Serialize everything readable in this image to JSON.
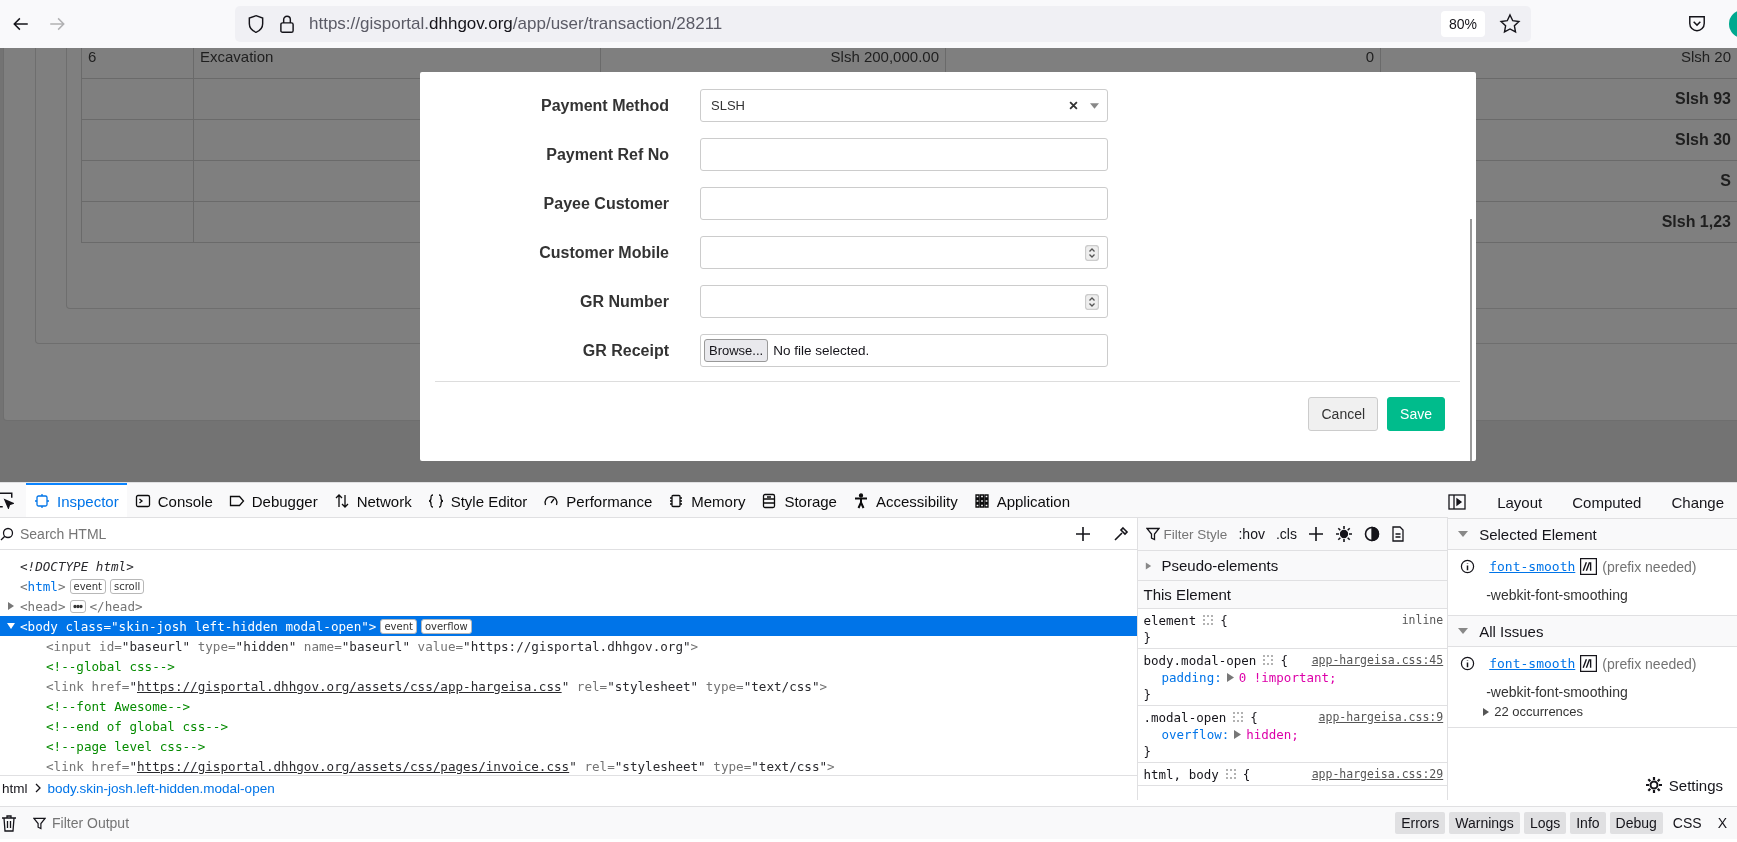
{
  "browser": {
    "back_button": {
      "disabled": false
    },
    "forward_button": {
      "disabled": true
    },
    "url": [
      {
        "text": "https://gisportal.",
        "emphasis": false
      },
      {
        "text": "dhhgov.org",
        "emphasis": true
      },
      {
        "text": "/app/user/transaction/28211",
        "emphasis": false
      }
    ],
    "zoom": "80%"
  },
  "page": {
    "table": {
      "rows": [
        {
          "bold": false,
          "column_1": "6",
          "column_2": "Excavation",
          "column_3": "Slsh 200,000.00",
          "column_4": "0",
          "column_5": "Slsh 20"
        },
        {
          "bold": true,
          "column_5": "Slsh 93"
        },
        {
          "bold": true,
          "column_5": "Slsh 30"
        },
        {
          "bold": true,
          "column_5": "S"
        },
        {
          "bold": true,
          "column_5": "Slsh 1,23"
        }
      ]
    }
  },
  "modal": {
    "fields": [
      {
        "label": "Payment Method",
        "kind": "select",
        "value": "SLSH"
      },
      {
        "label": "Payment Ref No",
        "kind": "text"
      },
      {
        "label": "Payee Customer",
        "kind": "text"
      },
      {
        "label": "Customer Mobile",
        "kind": "number"
      },
      {
        "label": "GR Number",
        "kind": "number"
      },
      {
        "label": "GR Receipt",
        "kind": "file",
        "button": "Browse...",
        "status": "No file selected."
      }
    ],
    "buttons": [
      {
        "label": "Cancel",
        "kind": "secondary"
      },
      {
        "label": "Save",
        "kind": "primary"
      }
    ]
  },
  "devtools": {
    "tabs": [
      {
        "label": "Inspector",
        "selected": true
      },
      {
        "label": "Console",
        "selected": false
      },
      {
        "label": "Debugger",
        "selected": false
      },
      {
        "label": "Network",
        "selected": false
      },
      {
        "label": "Style Editor",
        "selected": false
      },
      {
        "label": "Performance",
        "selected": false
      },
      {
        "label": "Memory",
        "selected": false
      },
      {
        "label": "Storage",
        "selected": false
      },
      {
        "label": "Accessibility",
        "selected": false
      },
      {
        "label": "Application",
        "selected": false
      }
    ],
    "search": {
      "placeholder": "Search HTML"
    },
    "markup": [
      {
        "selected": false,
        "parts": [
          {
            "kind": "doctype",
            "text": "<!DOCTYPE html>"
          }
        ]
      },
      {
        "selected": false,
        "parts": [
          {
            "kind": "punct",
            "text": "<"
          },
          {
            "kind": "tag",
            "text": "html"
          },
          {
            "kind": "punct",
            "text": ">"
          },
          {
            "kind": "badge",
            "text": "event"
          },
          {
            "kind": "badge",
            "text": "scroll"
          }
        ]
      },
      {
        "selected": false,
        "expanded": false,
        "parts": [
          {
            "kind": "punct",
            "text": "<head>"
          },
          {
            "kind": "ellipsis"
          },
          {
            "kind": "punct",
            "text": "</head>"
          }
        ]
      },
      {
        "selected": true,
        "expanded": true,
        "parts": [
          {
            "kind": "punct",
            "text": "<"
          },
          {
            "kind": "tag",
            "text": "body"
          },
          {
            "kind": "attr",
            "text": " class="
          },
          {
            "kind": "value",
            "text": "\"skin-josh left-hidden modal-open\""
          },
          {
            "kind": "punct",
            "text": ">"
          },
          {
            "kind": "badge",
            "text": "event"
          },
          {
            "kind": "badge",
            "text": "overflow"
          }
        ],
        "children": [
          {
            "selected": false,
            "parts": [
              {
                "kind": "punct",
                "text": "<input"
              },
              {
                "kind": "attr",
                "text": " id="
              },
              {
                "kind": "value",
                "text": "\"baseurl\""
              },
              {
                "kind": "attr",
                "text": " type="
              },
              {
                "kind": "value",
                "text": "\"hidden\""
              },
              {
                "kind": "attr",
                "text": " name="
              },
              {
                "kind": "value",
                "text": "\"baseurl\""
              },
              {
                "kind": "attr",
                "text": " value="
              },
              {
                "kind": "value",
                "text": "\"https://gisportal.dhhgov.org\""
              },
              {
                "kind": "punct",
                "text": ">"
              }
            ]
          },
          {
            "selected": false,
            "parts": [
              {
                "kind": "comment",
                "text": "<!--global css-->"
              }
            ]
          },
          {
            "selected": false,
            "parts": [
              {
                "kind": "punct",
                "text": "<link"
              },
              {
                "kind": "attr",
                "text": " href="
              },
              {
                "kind": "value",
                "text": "\""
              },
              {
                "kind": "link",
                "text": "https://gisportal.dhhgov.org/assets/css/app-hargeisa.css"
              },
              {
                "kind": "value",
                "text": "\""
              },
              {
                "kind": "attr",
                "text": " rel="
              },
              {
                "kind": "value",
                "text": "\"stylesheet\""
              },
              {
                "kind": "attr",
                "text": " type="
              },
              {
                "kind": "value",
                "text": "\"text/css\""
              },
              {
                "kind": "punct",
                "text": ">"
              }
            ]
          },
          {
            "selected": false,
            "parts": [
              {
                "kind": "comment",
                "text": "<!--font Awesome-->"
              }
            ]
          },
          {
            "selected": false,
            "parts": [
              {
                "kind": "comment",
                "text": "<!--end of global css-->"
              }
            ]
          },
          {
            "selected": false,
            "parts": [
              {
                "kind": "comment",
                "text": "<!--page level css-->"
              }
            ]
          },
          {
            "selected": false,
            "parts": [
              {
                "kind": "punct",
                "text": "<link"
              },
              {
                "kind": "attr",
                "text": " href="
              },
              {
                "kind": "value",
                "text": "\""
              },
              {
                "kind": "link",
                "text": "https://gisportal.dhhgov.org/assets/css/pages/invoice.css"
              },
              {
                "kind": "value",
                "text": "\""
              },
              {
                "kind": "attr",
                "text": " rel="
              },
              {
                "kind": "value",
                "text": "\"stylesheet\""
              },
              {
                "kind": "attr",
                "text": " type="
              },
              {
                "kind": "value",
                "text": "\"text/css\""
              },
              {
                "kind": "punct",
                "text": ">"
              }
            ]
          }
        ]
      }
    ],
    "breadcrumb": [
      {
        "label": "html",
        "selected": false
      },
      {
        "label": "body.skin-josh.left-hidden.modal-open",
        "selected": true
      }
    ],
    "rules": {
      "filter": {
        "placeholder": "Filter Style"
      },
      "toggles": [
        ":hov",
        ".cls"
      ],
      "pseudo_elements": {
        "label": "Pseudo-elements",
        "expanded": false
      },
      "header": "This Element",
      "list": [
        {
          "selector": "element",
          "open": "{",
          "source": "inline",
          "source_link": false,
          "close": "}"
        },
        {
          "selector": "body.modal-open",
          "open": "{",
          "source": "app-hargeisa.css:45",
          "source_link": true,
          "declarations": [
            {
              "property": "padding:",
              "value": "0 !important;"
            }
          ],
          "close": "}"
        },
        {
          "selector": ".modal-open",
          "open": "{",
          "source": "app-hargeisa.css:9",
          "source_link": true,
          "declarations": [
            {
              "property": "overflow:",
              "value": "hidden;"
            }
          ],
          "close": "}"
        },
        {
          "selector": "html, body",
          "open": "{",
          "source": "app-hargeisa.css:29",
          "source_link": true
        }
      ]
    },
    "sidebar": {
      "tabs": [
        {
          "label": "Layout",
          "selected": false
        },
        {
          "label": "Computed",
          "selected": false
        },
        {
          "label": "Change",
          "selected": false
        }
      ],
      "sections": [
        {
          "title": "Selected Element",
          "expanded": true,
          "issues": [
            {
              "property": "font-smooth",
              "note": "(prefix needed)",
              "detail": "-webkit-font-smoothing"
            }
          ]
        },
        {
          "title": "All Issues",
          "expanded": true,
          "issues": [
            {
              "property": "font-smooth",
              "note": "(prefix needed)",
              "detail": "-webkit-font-smoothing",
              "occurrences": "22 occurrences"
            }
          ]
        }
      ],
      "settings": "Settings"
    }
  },
  "console": {
    "filter": {
      "placeholder": "Filter Output"
    },
    "levels": [
      {
        "label": "Errors",
        "selected": true
      },
      {
        "label": "Warnings",
        "selected": true
      },
      {
        "label": "Logs",
        "selected": true
      },
      {
        "label": "Info",
        "selected": true
      },
      {
        "label": "Debug",
        "selected": true
      },
      {
        "label": "CSS",
        "selected": false
      },
      {
        "label": "X",
        "selected": false
      }
    ]
  }
}
